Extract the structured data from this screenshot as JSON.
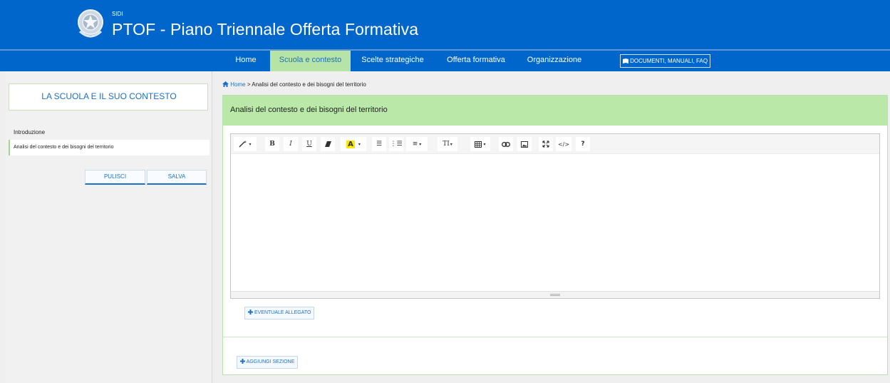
{
  "header": {
    "org_label": "SIDI",
    "app_title": "PTOF - Piano Triennale Offerta Formativa"
  },
  "nav": {
    "items": [
      "Home",
      "Scuola e contesto",
      "Scelte strategiche",
      "Offerta formativa",
      "Organizzazione"
    ],
    "active": "Scuola e contesto",
    "docs_label": "DOCUMENTI, MANUALI, FAQ"
  },
  "sidebar": {
    "title": "LA SCUOLA E IL SUO CONTESTO",
    "intro_label": "Introduzione",
    "items": [
      "Analisi del contesto e dei bisogni del territorio"
    ],
    "clear_button": "PULISCI",
    "save_button": "SALVA"
  },
  "breadcrumb": {
    "home": "Home",
    "separator": ">",
    "current": "Analisi del contesto e dei bisogni del territorio"
  },
  "section": {
    "title": "Analisi del contesto e dei bisogni del territorio",
    "attachment_button": "EVENTUALE ALLEGATO",
    "add_section_button": "AGGIUNGI SEZIONE"
  },
  "toolbar_icons": [
    "magic-icon",
    "bold-icon",
    "italic-icon",
    "underline-icon",
    "eraser-icon",
    "font-color-icon",
    "bullet-list-icon",
    "numbered-list-icon",
    "align-icon",
    "text-size-icon",
    "table-icon",
    "link-icon",
    "image-icon",
    "fullscreen-icon",
    "code-view-icon",
    "help-icon"
  ],
  "colors": {
    "primary": "#0066cc",
    "accent_green": "#b9e8a9",
    "link": "#1d70c7"
  }
}
